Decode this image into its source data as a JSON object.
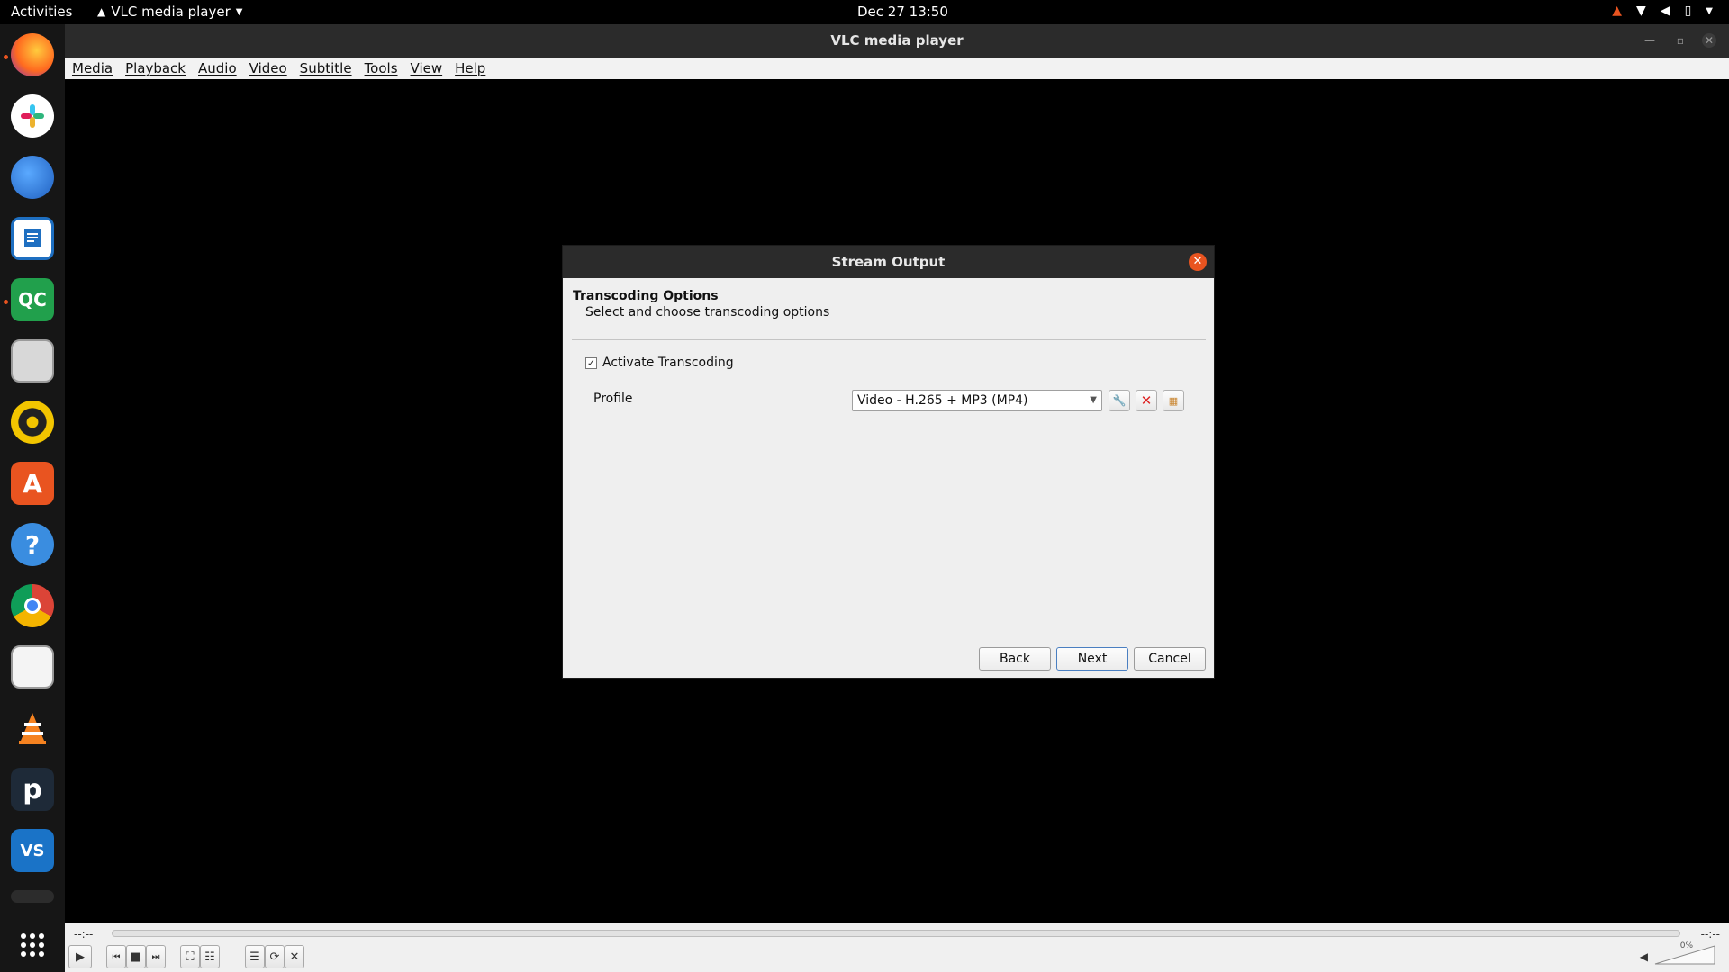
{
  "topbar": {
    "activities": "Activities",
    "app_name": "VLC media player",
    "clock": "Dec 27  13:50"
  },
  "window": {
    "title": "VLC media player",
    "menu": [
      "Media",
      "Playback",
      "Audio",
      "Video",
      "Subtitle",
      "Tools",
      "View",
      "Help"
    ]
  },
  "controls": {
    "time_elapsed": "--:--",
    "time_total": "--:--",
    "volume_percent": "0%"
  },
  "dialog": {
    "title": "Stream Output",
    "heading": "Transcoding Options",
    "subheading": "Select and choose transcoding options",
    "activate_label": "Activate Transcoding",
    "activate_checked": true,
    "profile_label": "Profile",
    "profile_value": "Video - H.265 + MP3 (MP4)",
    "buttons": {
      "back": "Back",
      "next": "Next",
      "cancel": "Cancel"
    }
  },
  "dock": {
    "qc_label": "QC",
    "vs_label": "VS"
  },
  "colors": {
    "accent": "#e95420",
    "titlebar": "#2b2b2b",
    "dialog_bg": "#efefef"
  }
}
